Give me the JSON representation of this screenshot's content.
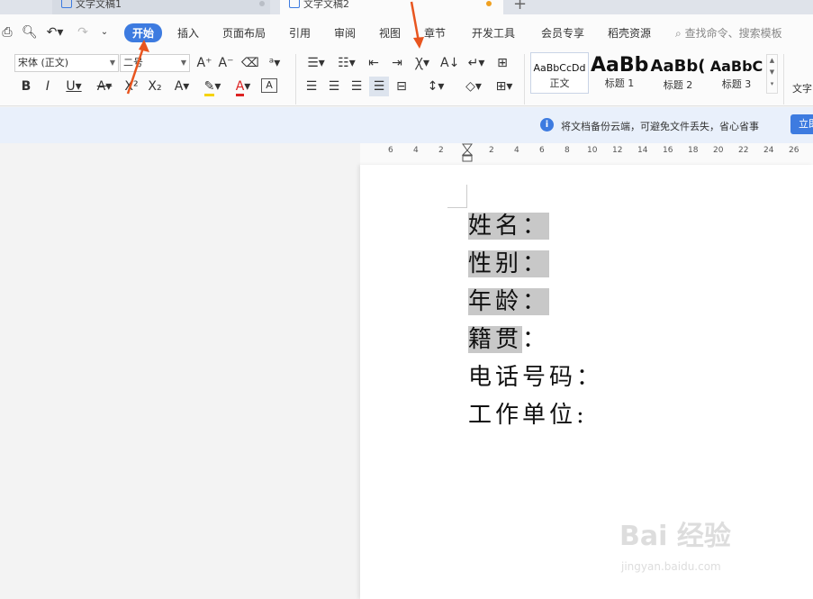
{
  "tabs": [
    {
      "label": "文字文稿1"
    },
    {
      "label": "文字文稿2"
    }
  ],
  "menu": {
    "items": [
      "开始",
      "插入",
      "页面布局",
      "引用",
      "审阅",
      "视图",
      "章节",
      "开发工具",
      "会员专享",
      "稻壳资源"
    ],
    "search_placeholder": "查找命令、搜索模板"
  },
  "ribbon": {
    "font_name": "宋体 (正文)",
    "font_size": "二号",
    "styles": [
      {
        "sample": "AaBbCcDd",
        "name": "正文"
      },
      {
        "sample": "AaBb",
        "name": "标题 1"
      },
      {
        "sample": "AaBb(",
        "name": "标题 2"
      },
      {
        "sample": "AaBbC",
        "name": "标题 3"
      }
    ],
    "text_label": "文字"
  },
  "infobar": {
    "message": "将文档备份云端，可避免文件丢失，省心省事",
    "button_label": "立即"
  },
  "ruler": {
    "ticks": [
      "6",
      "4",
      "2",
      "2",
      "4",
      "6",
      "8",
      "10",
      "12",
      "14",
      "16",
      "18",
      "20",
      "22",
      "24",
      "26"
    ]
  },
  "document": {
    "lines": [
      {
        "text": "姓名",
        "suffix": "："
      },
      {
        "text": "性别",
        "suffix": "："
      },
      {
        "text": "年龄",
        "suffix": "："
      },
      {
        "text": "籍贯",
        "suffix": "："
      },
      {
        "text": "电话号码",
        "suffix": "："
      },
      {
        "text": "工作单位",
        "suffix": ":"
      }
    ]
  },
  "watermark": {
    "main": "Bai 经验",
    "sub": "jingyan.baidu.com"
  },
  "colors": {
    "accent": "#3d7be0",
    "arrow": "#e8551f",
    "highlight": "#c8c8c8"
  }
}
